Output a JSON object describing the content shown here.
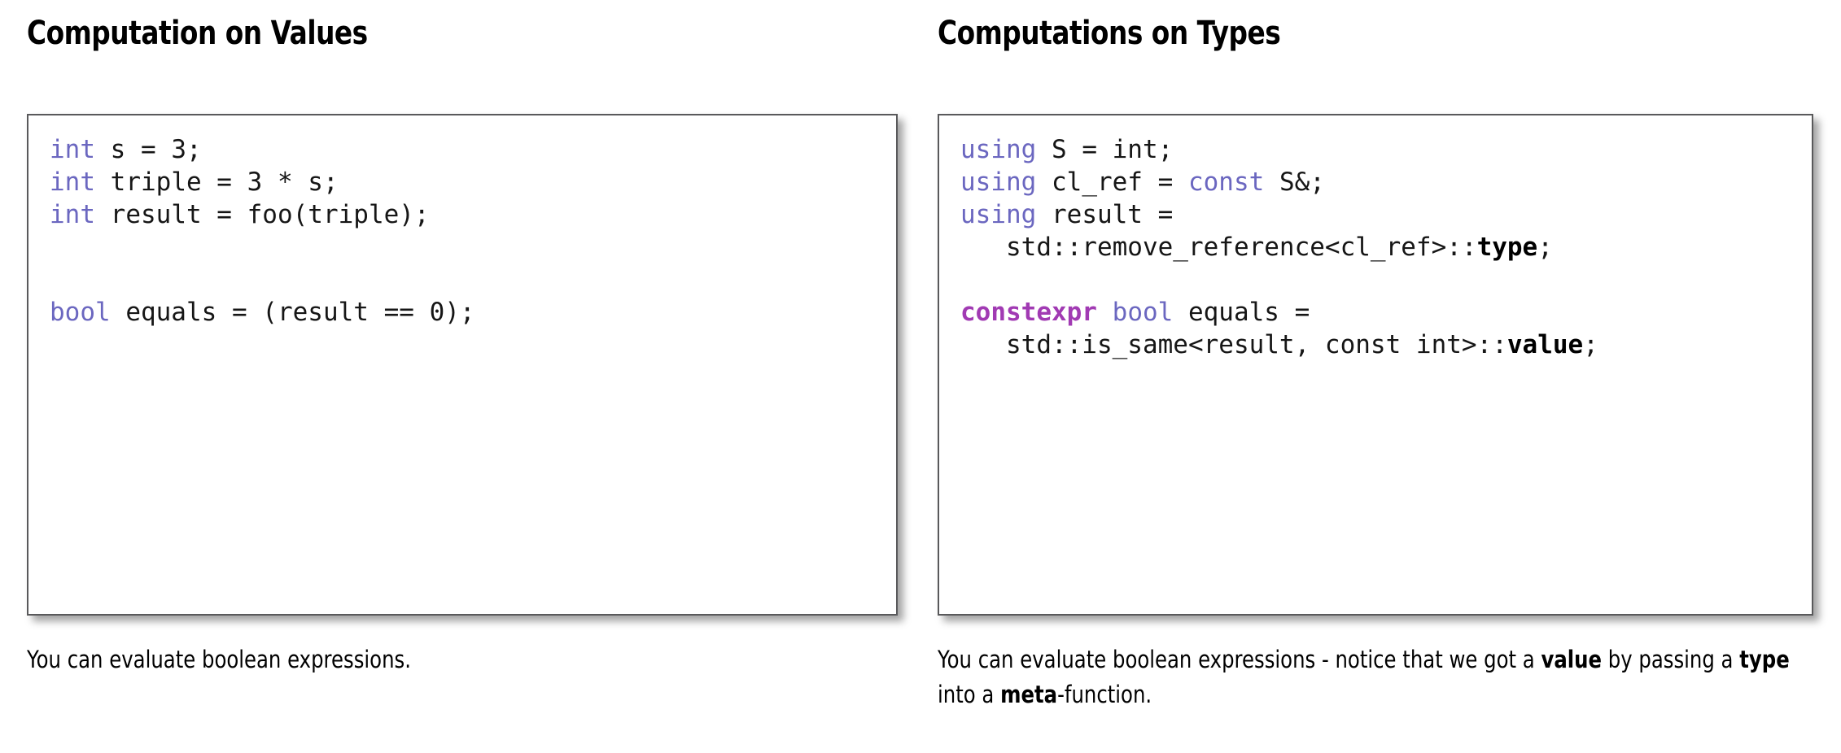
{
  "slide": {
    "background_color": "#ffffff",
    "columns": [
      {
        "id": "values",
        "heading": "Computation on Values",
        "code_lines": [
          [
            {
              "t": "int",
              "s": "kw"
            },
            {
              "t": " s = 3;",
              "s": "plain"
            }
          ],
          [
            {
              "t": "int",
              "s": "kw"
            },
            {
              "t": " triple = 3 * s;",
              "s": "plain"
            }
          ],
          [
            {
              "t": "int",
              "s": "kw"
            },
            {
              "t": " result = foo(triple);",
              "s": "plain"
            }
          ],
          [],
          [],
          [
            {
              "t": "bool",
              "s": "kw"
            },
            {
              "t": " equals = (result == 0);",
              "s": "plain"
            }
          ]
        ],
        "code_plain": "int s = 3;\nint triple = 3 * s;\nint result = foo(triple);\n\n\nbool equals = (result == 0);",
        "caption_runs": [
          {
            "t": "You can evaluate boolean expressions.",
            "s": "plain"
          }
        ],
        "caption_plain": "You can evaluate boolean expressions."
      },
      {
        "id": "types",
        "heading": "Computations on Types",
        "code_lines": [
          [
            {
              "t": "using",
              "s": "kw"
            },
            {
              "t": " S = int;",
              "s": "plain"
            }
          ],
          [
            {
              "t": "using",
              "s": "kw"
            },
            {
              "t": " cl_ref = ",
              "s": "plain"
            },
            {
              "t": "const",
              "s": "kw"
            },
            {
              "t": " S&;",
              "s": "plain"
            }
          ],
          [
            {
              "t": "using",
              "s": "kw"
            },
            {
              "t": " result =",
              "s": "plain"
            }
          ],
          [
            {
              "t": "   std::remove_reference<cl_ref>::",
              "s": "plain"
            },
            {
              "t": "type",
              "s": "bold"
            },
            {
              "t": ";",
              "s": "plain"
            }
          ],
          [],
          [
            {
              "t": "constexpr",
              "s": "kwb"
            },
            {
              "t": " ",
              "s": "plain"
            },
            {
              "t": "bool",
              "s": "kw"
            },
            {
              "t": " equals =",
              "s": "plain"
            }
          ],
          [
            {
              "t": "   std::is_same<result, const int>::",
              "s": "plain"
            },
            {
              "t": "value",
              "s": "bold"
            },
            {
              "t": ";",
              "s": "plain"
            }
          ]
        ],
        "code_plain": "using S = int;\nusing cl_ref = const S&;\nusing result =\n   std::remove_reference<cl_ref>::type;\n\nconstexpr bool equals =\n   std::is_same<result, const int>::value;",
        "caption_runs": [
          {
            "t": "You can evaluate boolean expressions - notice that we got a ",
            "s": "plain"
          },
          {
            "t": "value",
            "s": "bold"
          },
          {
            "t": " by passing a ",
            "s": "plain"
          },
          {
            "t": "type",
            "s": "bold"
          },
          {
            "t": " into a ",
            "s": "plain"
          },
          {
            "t": "meta",
            "s": "bold"
          },
          {
            "t": "-function.",
            "s": "plain"
          }
        ],
        "caption_plain": "You can evaluate boolean expressions - notice that we got a value by passing a type into a meta-function."
      }
    ],
    "colors": {
      "keyword": "#6b67c0",
      "keyword_strong": "#a13ab3",
      "text": "#161616",
      "box_border": "#59595b",
      "background": "#ffffff"
    }
  }
}
